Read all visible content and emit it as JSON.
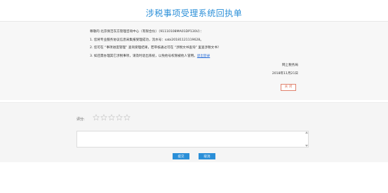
{
  "page": {
    "title": "涉税事项受理系统回执单"
  },
  "receipt": {
    "lines": [
      "尊敬的 北京保洁东方管理咨询中心（有限合伙）（91110108MA01DP130U）：",
      "1. 您将专业服务协议信息采集报受理成功，流水号：sabi20181121119628。",
      "2. 您可在 “事项进度管理” 查询受理结果，若审核通过可在 “涉税文书查询” 里查涉税文书！",
      "3. 如还需办理其它涉税事项，请及时退出系统，以免他号权限被他人冒用。"
    ],
    "logout_link": "退出登录",
    "signature": "网上税务局",
    "date": "2018年11月21日",
    "close_label": "关 闭"
  },
  "feedback": {
    "rating_label": "评分:",
    "stars_total": 5,
    "stars_filled": 0,
    "comment_value": "",
    "submit_label": "提交",
    "cancel_label": "取消"
  },
  "colors": {
    "accent": "#2b8fd8",
    "close": "#e0836e",
    "star": "#c8c8c8"
  }
}
